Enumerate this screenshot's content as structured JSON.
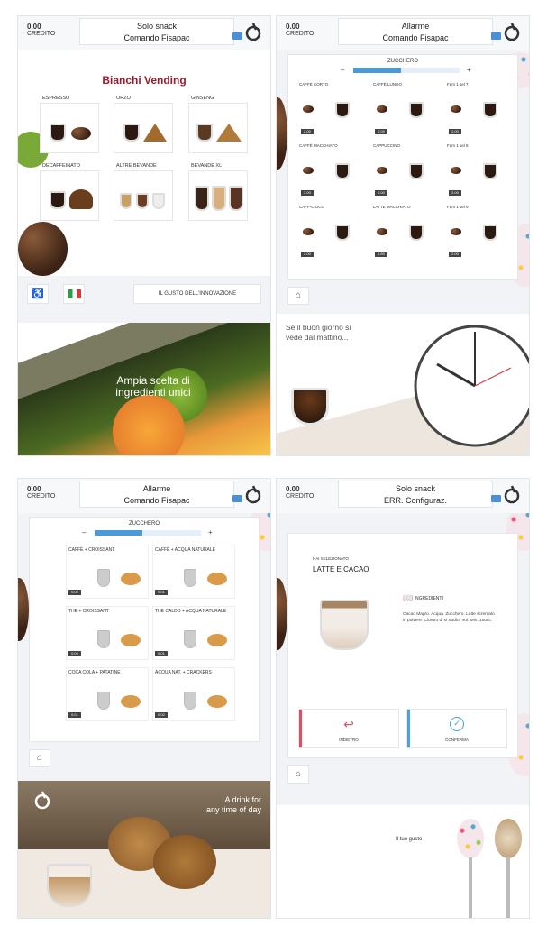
{
  "screen1": {
    "credit_amount": "0.00",
    "credit_label": "CREDITO",
    "status_line1": "Solo snack",
    "status_line2": "Comando Fisapac",
    "brand": "Bianchi Vending",
    "categories": [
      "ESPRESSO",
      "ORZO",
      "GINSENG",
      "DECAFFEINATO",
      "ALTRE BEVANDE",
      "BEVANDE XL"
    ],
    "slogan": "IL GUSTO DELL'INNOVAZIONE",
    "promo_line1": "Ampia scelta di",
    "promo_line2": "ingredienti unici"
  },
  "screen2": {
    "credit_amount": "0.00",
    "credit_label": "CREDITO",
    "status_line1": "Allarme",
    "status_line2": "Comando Fisapac",
    "sugar_label": "ZUCCHERO",
    "sugar_level": 0.45,
    "minus": "–",
    "plus": "+",
    "products": [
      {
        "name": "CAFFÈ CORTO",
        "price": "2.00"
      },
      {
        "name": "CAFFÈ LUNGO",
        "price": "2.00"
      },
      {
        "name": "Fam 1 sel 7",
        "price": "2.00"
      },
      {
        "name": "CAFFÈ MACCHIATO",
        "price": "2.00"
      },
      {
        "name": "CAPPUCCINO",
        "price": "2.00"
      },
      {
        "name": "Fam 1 sel 8",
        "price": "2.00"
      },
      {
        "name": "CAFF-CIOCC",
        "price": "2.00"
      },
      {
        "name": "LATTE MACCHIATO",
        "price": "1.50"
      },
      {
        "name": "Fam 1 sel 9",
        "price": "2.00"
      }
    ],
    "promo_line1": "Se il buon giorno si",
    "promo_line2": "vede dal mattino..."
  },
  "screen3": {
    "credit_amount": "0.00",
    "credit_label": "CREDITO",
    "status_line1": "Allarme",
    "status_line2": "Comando Fisapac",
    "sugar_label": "ZUCCHERO",
    "sugar_level": 0.45,
    "minus": "–",
    "plus": "+",
    "combos": [
      {
        "name": "CAFFÈ + CROISSANT",
        "price": "0.02"
      },
      {
        "name": "CAFFÈ + ACQUA NATURALE",
        "price": "0.01"
      },
      {
        "name": "THE + CROISSANT",
        "price": "0.02"
      },
      {
        "name": "THE CALDO + ACQUA NATURALE",
        "price": "0.01"
      },
      {
        "name": "COCA COLA + PATATINE",
        "price": "0.01"
      },
      {
        "name": "ACQUA NAT. + CRACKERS",
        "price": "0.02"
      }
    ],
    "promo_line1": "A drink for",
    "promo_line2": "any time of day"
  },
  "screen4": {
    "credit_amount": "0.00",
    "credit_label": "CREDITO",
    "status_line1": "Solo snack",
    "status_line2": "ERR. Configuraz.",
    "selected_label": "HAI SELEZIONATO",
    "selected_product": "LATTE E CACAO",
    "ingredients_title": "INGREDIENTI",
    "ingredients_text": "Cacao Magro. Acqua. Zucchero. Latte scremato in polvere. Cloruro di si Sodio. Vol. Min. 150cc.",
    "back_label": "INDIETRO",
    "confirm_label": "CONFERMA",
    "promo_text": "Il tuo gusto",
    "back_color": "#e05060",
    "confirm_color": "#4aa3df"
  }
}
